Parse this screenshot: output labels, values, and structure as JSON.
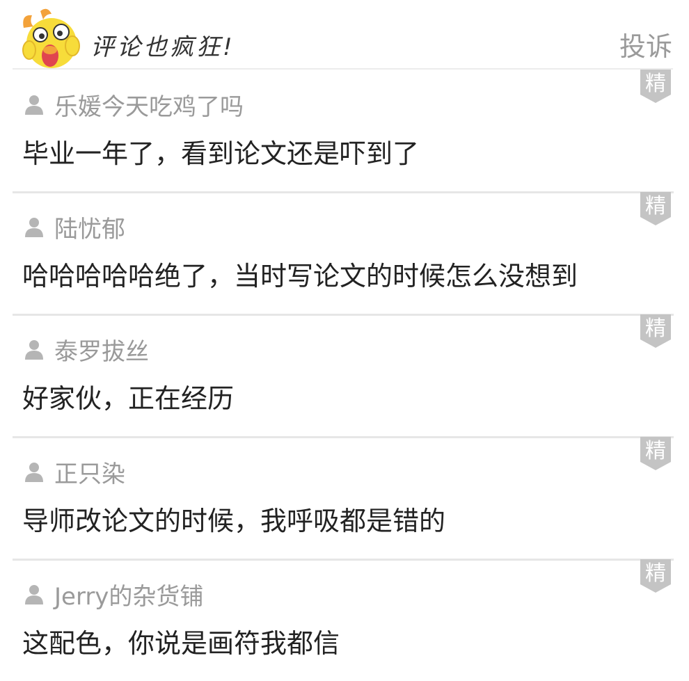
{
  "header": {
    "title": "评论也疯狂!",
    "report_label": "投诉",
    "mascot_icon": "yellow-chick-mascot-icon"
  },
  "badge_label": "精",
  "comments": [
    {
      "username": "乐媛今天吃鸡了吗",
      "text": "毕业一年了，看到论文还是吓到了"
    },
    {
      "username": "陆忧郁",
      "text": "哈哈哈哈哈绝了，当时写论文的时候怎么没想到"
    },
    {
      "username": "泰罗拔丝",
      "text": "好家伙，正在经历"
    },
    {
      "username": "正只染",
      "text": "导师改论文的时候，我呼吸都是错的"
    },
    {
      "username": "Jerry的杂货铺",
      "text": "这配色，你说是画符我都信"
    }
  ],
  "colors": {
    "username": "#9a9a9a",
    "text": "#222222",
    "badge": "#c4c4c4",
    "divider": "#e6e6e6"
  }
}
